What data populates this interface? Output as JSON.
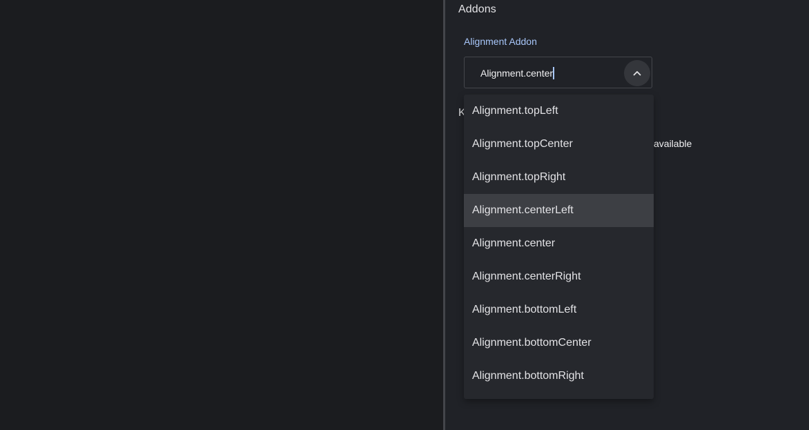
{
  "panel": {
    "section_title": "Addons",
    "partial_heading": "K",
    "partial_text": "available"
  },
  "alignment_field": {
    "label": "Alignment Addon",
    "value": "Alignment.center",
    "icon": "chevron-up-icon"
  },
  "dropdown": {
    "highlighted_index": 3,
    "options": [
      {
        "label": "Alignment.topLeft"
      },
      {
        "label": "Alignment.topCenter"
      },
      {
        "label": "Alignment.topRight"
      },
      {
        "label": "Alignment.centerLeft"
      },
      {
        "label": "Alignment.center"
      },
      {
        "label": "Alignment.centerRight"
      },
      {
        "label": "Alignment.bottomLeft"
      },
      {
        "label": "Alignment.bottomCenter"
      },
      {
        "label": "Alignment.bottomRight"
      }
    ]
  },
  "colors": {
    "background": "#1b1c1f",
    "panel": "#202227",
    "menu": "#26282d",
    "highlight": "#3d3f44",
    "accent": "#a8c7fa",
    "text": "#e3e3e6"
  }
}
